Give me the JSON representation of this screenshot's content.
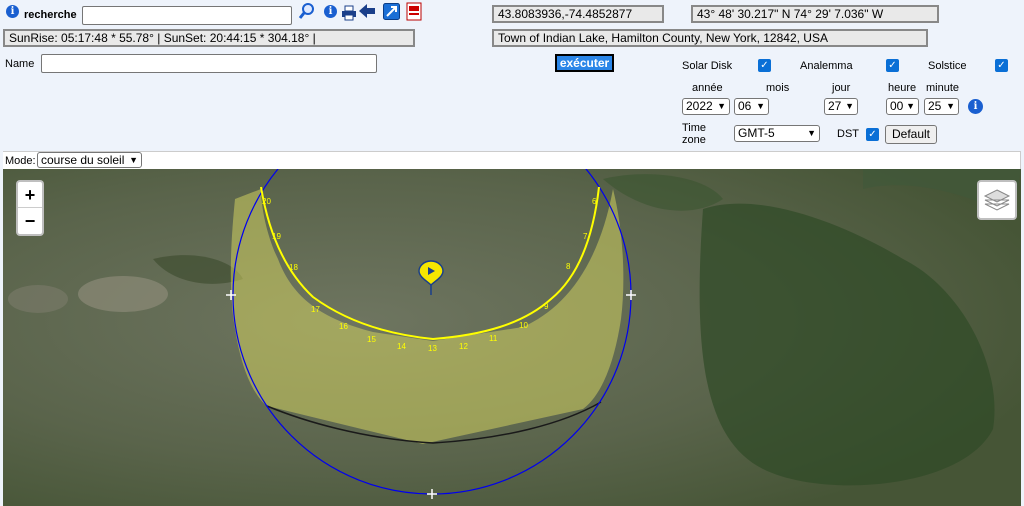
{
  "header": {
    "search_label": "recherche",
    "search_value": "",
    "coords_decimal": "43.8083936,-74.4852877",
    "coords_dms": "43° 48' 30.217\" N     74° 29' 7.036\" W",
    "sun_info": "SunRise: 05:17:48 * 55.78° | SunSet: 20:44:15 * 304.18° |",
    "address": "Town of Indian Lake, Hamilton County, New York, 12842, USA",
    "name_label": "Name",
    "name_value": "",
    "execute_label": "exécuter"
  },
  "options": {
    "solar_disk_label": "Solar Disk",
    "analemma_label": "Analemma",
    "solstice_label": "Solstice",
    "solar_disk_checked": true,
    "analemma_checked": true,
    "solstice_checked": true,
    "year_label": "année",
    "month_label": "mois",
    "day_label": "jour",
    "hour_label": "heure",
    "minute_label": "minute",
    "year": "2022",
    "month": "06",
    "day": "27",
    "hour": "00",
    "minute": "25",
    "timezone_label_1": "Time",
    "timezone_label_2": "zone",
    "timezone": "GMT-5",
    "dst_label": "DST",
    "dst_checked": true,
    "default_label": "Default"
  },
  "mode": {
    "label": "Mode:",
    "value": "course du soleil"
  },
  "map": {
    "zoom_in": "+",
    "zoom_out": "−",
    "hour_labels": [
      "20",
      "19",
      "18",
      "17",
      "16",
      "15",
      "14",
      "13",
      "12",
      "11",
      "10",
      "9",
      "8",
      "7",
      "6"
    ]
  },
  "colors": {
    "sun_path": "#ffff00",
    "horizon_circle": "#0000ff",
    "shade_fill": "#c8c850",
    "accent": "#1a5fd0"
  }
}
